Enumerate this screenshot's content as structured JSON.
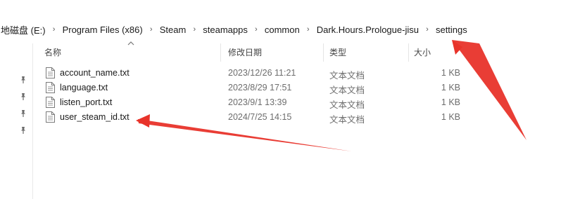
{
  "breadcrumb": {
    "items": [
      "地磁盘 (E:)",
      "Program Files (x86)",
      "Steam",
      "steamapps",
      "common",
      "Dark.Hours.Prologue-jisu",
      "settings"
    ],
    "separator": "›"
  },
  "columns": {
    "name": "名称",
    "date": "修改日期",
    "type": "类型",
    "size": "大小"
  },
  "files": [
    {
      "name": "account_name.txt",
      "date": "2023/12/26 11:21",
      "type": "文本文档",
      "size": "1 KB"
    },
    {
      "name": "language.txt",
      "date": "2023/8/29 17:51",
      "type": "文本文档",
      "size": "1 KB"
    },
    {
      "name": "listen_port.txt",
      "date": "2023/9/1 13:39",
      "type": "文本文档",
      "size": "1 KB"
    },
    {
      "name": "user_steam_id.txt",
      "date": "2024/7/25 14:15",
      "type": "文本文档",
      "size": "1 KB"
    }
  ],
  "icons": {
    "file": "text-file-icon",
    "pin": "pin-icon",
    "sort": "sort-up-icon"
  },
  "colors": {
    "annotation_arrow": "#e8332a"
  }
}
